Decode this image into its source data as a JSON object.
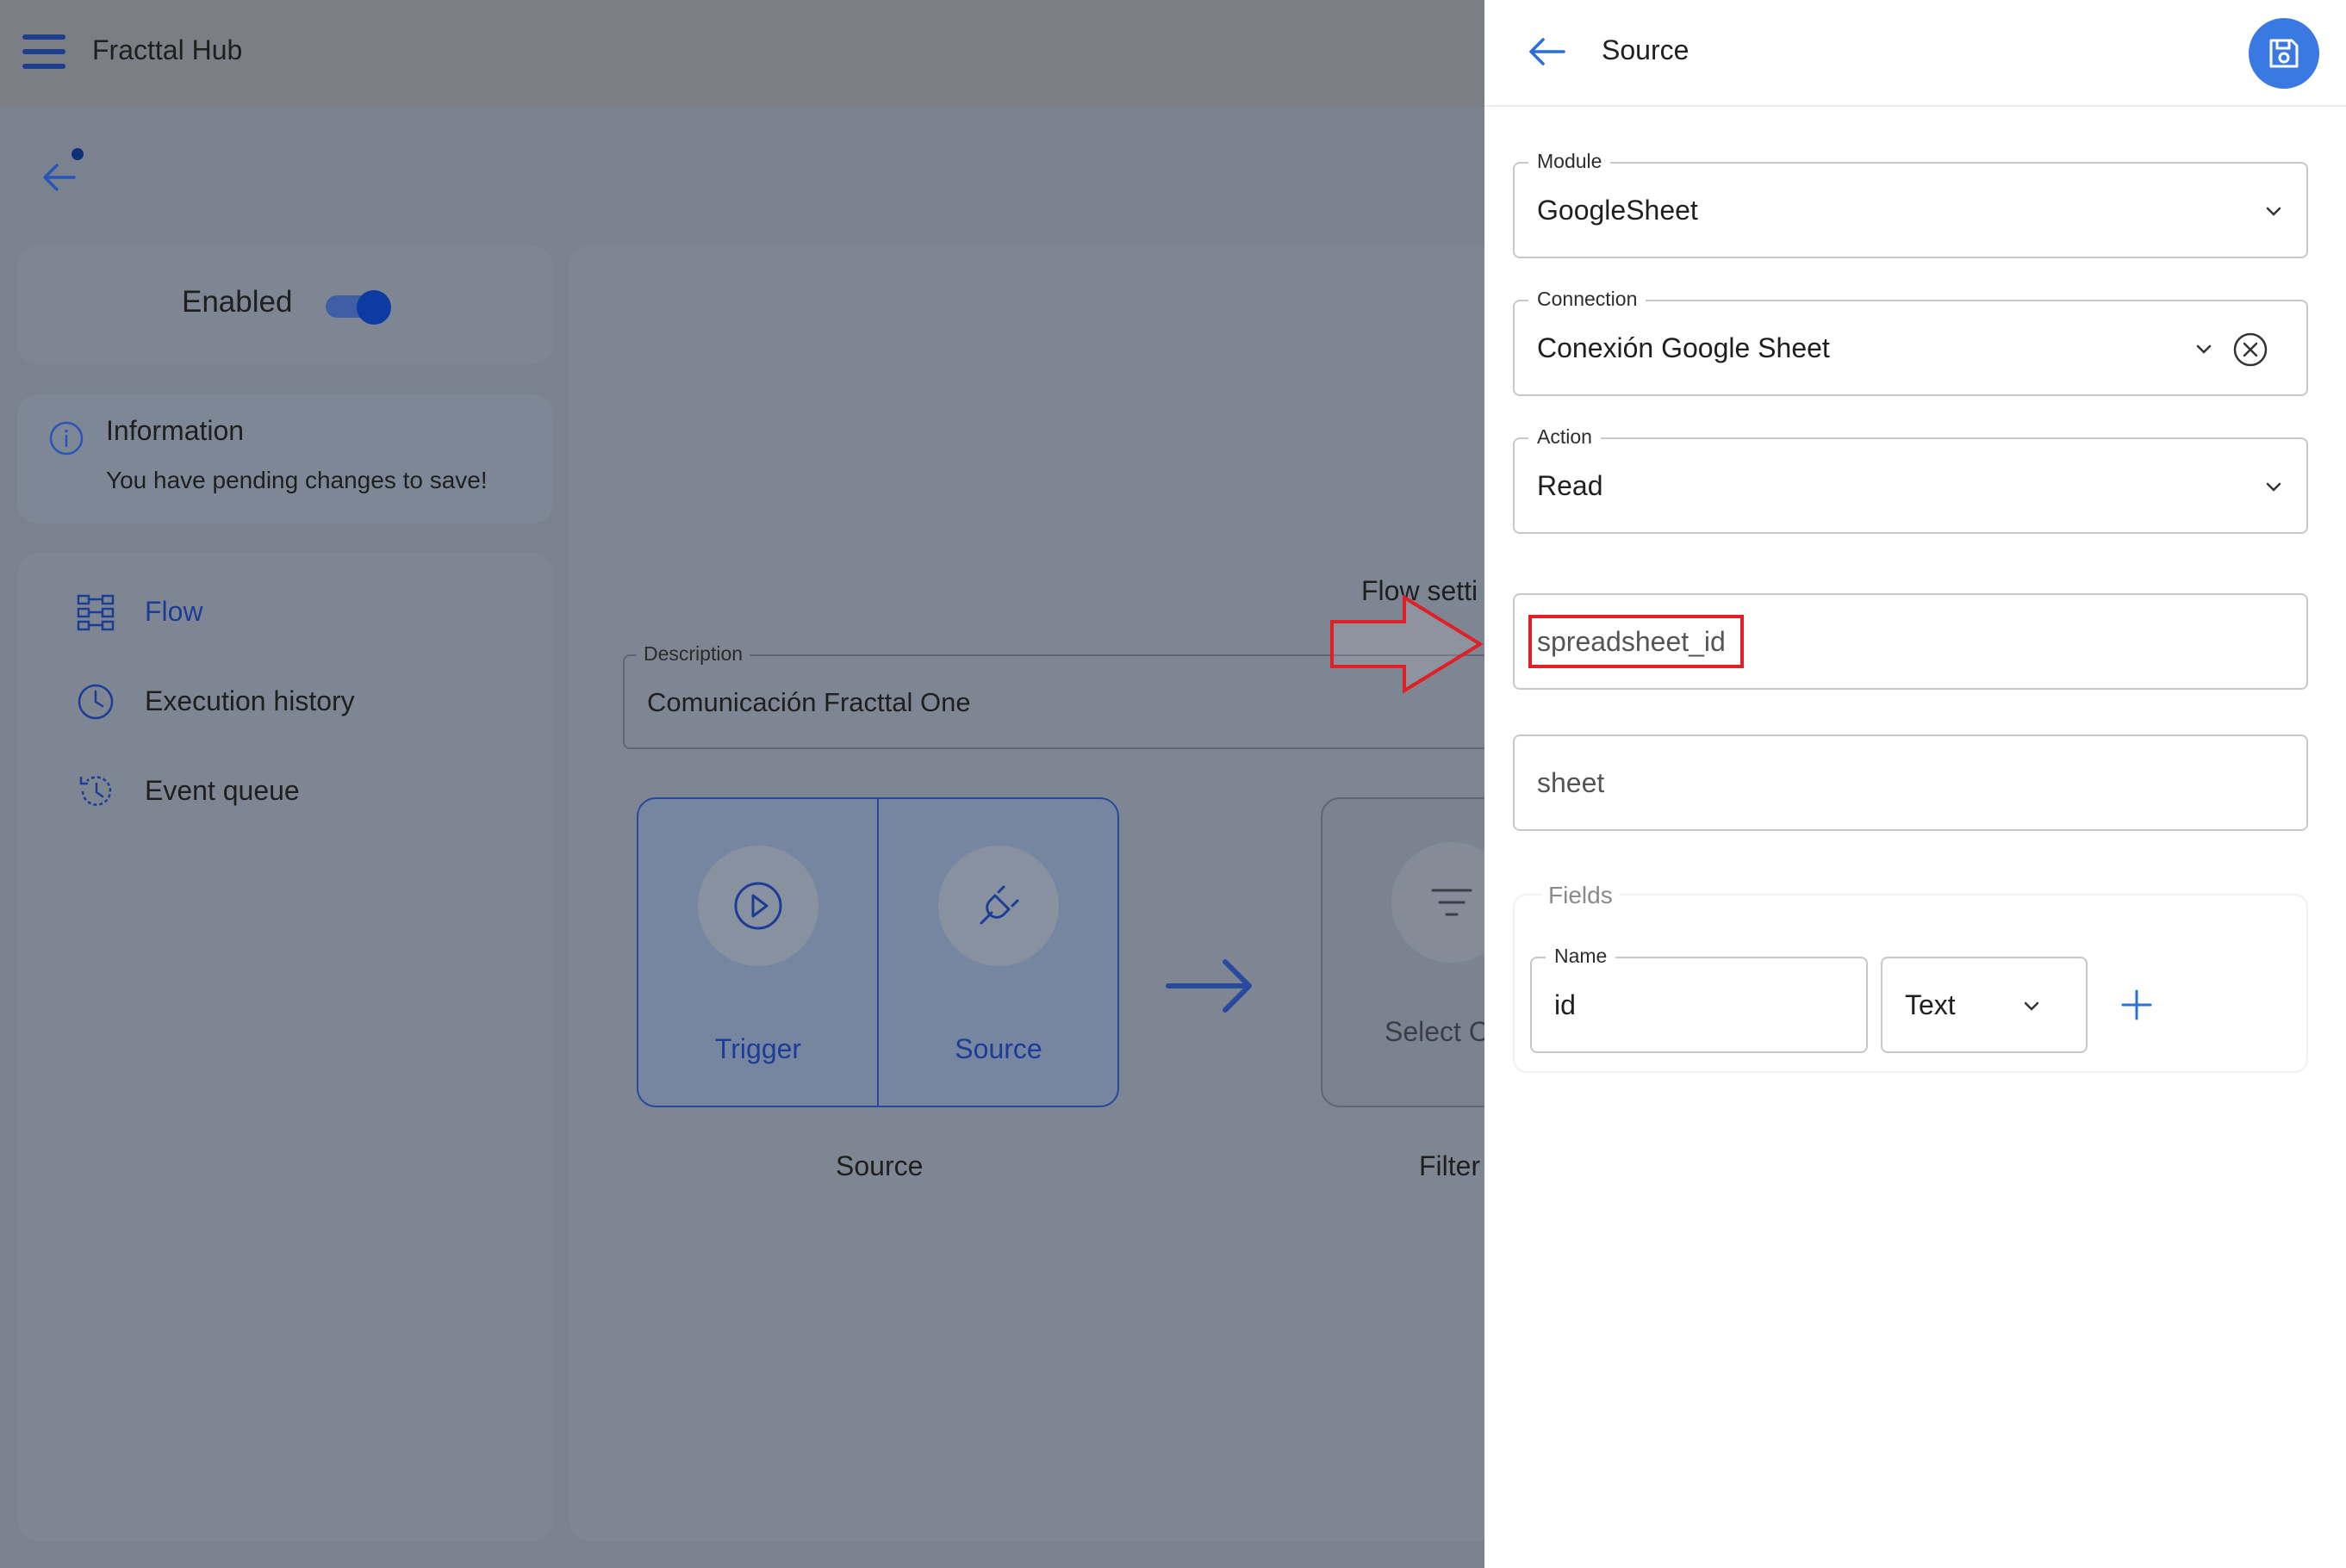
{
  "app": {
    "title": "Fracttal Hub"
  },
  "sidebar": {
    "enabled_label": "Enabled",
    "enabled_on": true,
    "information": {
      "title": "Information",
      "text": "You have pending changes to save!"
    },
    "nav": [
      {
        "label": "Flow",
        "icon": "flow-icon",
        "active": true
      },
      {
        "label": "Execution history",
        "icon": "clock-icon",
        "active": false
      },
      {
        "label": "Event queue",
        "icon": "history-icon",
        "active": false
      }
    ]
  },
  "main": {
    "flow_settings_title": "Flow setti",
    "description": {
      "label": "Description",
      "value": "Comunicación Fracttal One"
    },
    "source_group": {
      "trigger_label": "Trigger",
      "source_label": "Source",
      "caption": "Source"
    },
    "filter_group": {
      "select_label": "Select O",
      "caption": "Filter"
    }
  },
  "panel": {
    "title": "Source",
    "module": {
      "label": "Module",
      "value": "GoogleSheet"
    },
    "connection": {
      "label": "Connection",
      "value": "Conexión Google Sheet"
    },
    "action": {
      "label": "Action",
      "value": "Read"
    },
    "spreadsheet_id": {
      "placeholder": "spreadsheet_id"
    },
    "sheet": {
      "placeholder": "sheet"
    },
    "fields": {
      "title": "Fields",
      "name_label": "Name",
      "name_value": "id",
      "type_value": "Text"
    }
  },
  "colors": {
    "accent": "#3a78e2",
    "nav_active": "#1c3d96",
    "highlight": "#e01f26"
  }
}
